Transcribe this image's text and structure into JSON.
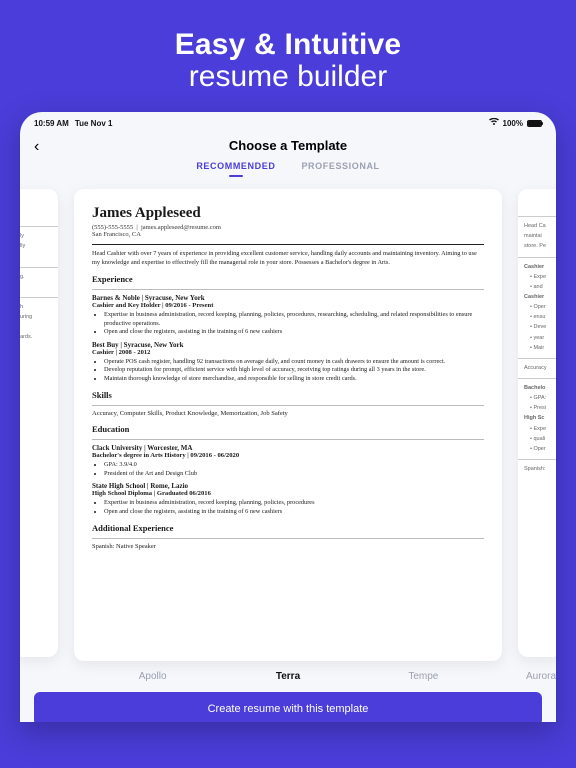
{
  "hero": {
    "line1": "Easy & Intuitive",
    "line2": "resume builder"
  },
  "status": {
    "time": "10:59 AM",
    "date": "Tue Nov 1",
    "battery": "100%"
  },
  "nav": {
    "title": "Choose a Template",
    "back": "‹"
  },
  "tabs": {
    "recommended": "RECOMMENDED",
    "professional": "PROFESSIONAL"
  },
  "resume": {
    "name": "James Appleseed",
    "phone": "(555)-555-5555",
    "email": "james.appleseed@resume.com",
    "location": "San Francisco, CA",
    "summary": "Head Cashier with over 7 years of experience in providing excellent customer service, handling daily accounts and maintaining inventory. Aiming to use my knowledge and expertise to effectively fill the managerial role in your store. Possesses a Bachelor's degree in Arts.",
    "sec_experience": "Experience",
    "job1_emp": "Barnes & Noble  |  Syracuse, New York",
    "job1_role": "Cashier and Key Holder  |  09/2016 - Present",
    "job1_b1": "Expertise in business administration, record keeping, planning, policies, procedures, researching, scheduling, and related responsibilities to ensure productive operations.",
    "job1_b2": "Open and close the registers, assisting in the training of 6 new cashiers",
    "job2_emp": "Best Buy  |  Syracuse, New York",
    "job2_role": "Cashier  |  2008 - 2012",
    "job2_b1": "Operate POS cash register, handling 92 transactions on average daily, and count money in cash drawers to ensure the amount is correct.",
    "job2_b2": "Develop reputation for prompt, efficient service with high level of accuracy, receiving top ratings during all 3 years in the store.",
    "job2_b3": "Maintain thorough knowledge of store merchandise, and responsible for selling in store credit cards.",
    "sec_skills": "Skills",
    "skills_line": "Accuracy, Computer Skills, Product Knowledge, Memorization, Job Safety",
    "sec_education": "Education",
    "edu1_school": "Clack University  |  Worcester, MA",
    "edu1_deg": "Bachelor's degree in Arts History  |  09/2016 - 06/2020",
    "edu1_b1": "GPA: 3.9/4.0",
    "edu1_b2": "President of the Art and Design Club",
    "edu2_school": "State High School  |  Rome, Lazio",
    "edu2_deg": "High School Diploma  |  Graduated 06/2016",
    "edu2_b1": "Expertise in business administration, record keeping, planning, policies, procedures",
    "edu2_b2": "Open and close the registers, assisting in the training of 6 new cashiers",
    "sec_additional": "Additional Experience",
    "additional": "Spanish: Native Speaker"
  },
  "right_ghost": {
    "g1": "Head Ca",
    "g2": "maintai",
    "g3": "store. Pe",
    "h1": "Cashier",
    "b1": "Expe",
    "b2": "and",
    "h2": "Cashier",
    "b3": "Oper",
    "b4": "ensu",
    "b5": "Deve",
    "b6": "year",
    "b7": "Mair",
    "sk": "Accuracy",
    "ed1": "Bachelo",
    "eb1": "GPA:",
    "eb2": "Presi",
    "ed2": "High Sc",
    "eb3": "Expe",
    "eb4": "quali",
    "eb5": "Oper",
    "lang": "Spanish:"
  },
  "templates": {
    "t1": "Apollo",
    "t2": "Terra",
    "t3": "Tempe",
    "t4": "Aurora"
  },
  "cta": "Create resume with this template"
}
